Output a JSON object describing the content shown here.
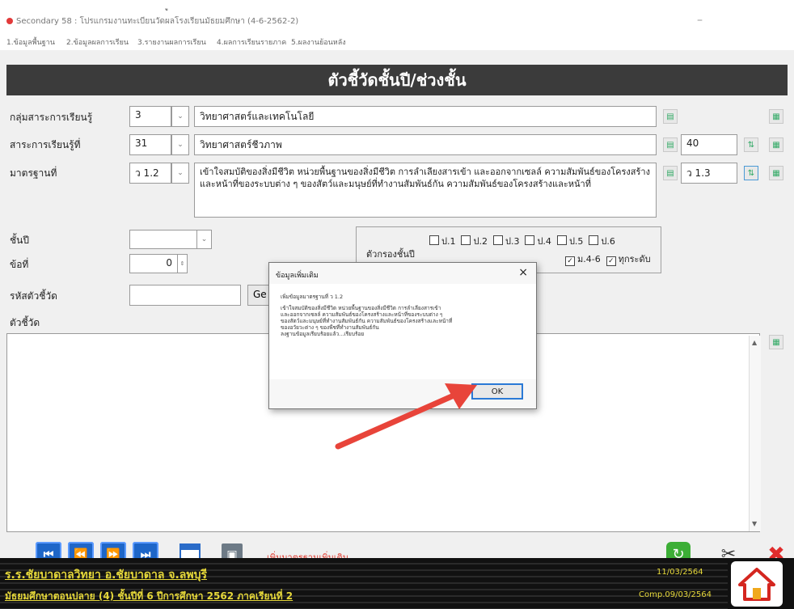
{
  "window": {
    "top_caption": "ู",
    "title": "Secondary 58 : โปรแกรมงานทะเบียนวัดผลโรงเรียนมัธยมศึกษา (4-6-2562-2)",
    "menu": [
      "1.ข้อมูลพื้นฐาน",
      "2.ข้อมูลผลการเรียน",
      "3.รายงานผลการเรียน",
      "4.ผลการเรียนรายภาค",
      "5.ผลงานย้อนหลัง"
    ]
  },
  "header": {
    "title": "ตัวชี้วัดชั้นปี/ช่วงชั้น"
  },
  "form": {
    "learning_area": {
      "label": "กลุ่มสาระการเรียนรู้",
      "code": "3",
      "name": "วิทยาศาสตร์และเทคโนโลยี"
    },
    "strand": {
      "label": "สาระการเรียนรู้ที่",
      "code": "31",
      "name": "วิทยาศาสตร์ชีวภาพ",
      "count": "40"
    },
    "standard": {
      "label": "มาตรฐานที่",
      "code": "ว 1.2",
      "text": "เข้าใจสมบัติของสิ่งมีชีวิต หน่วยพื้นฐานของสิ่งมีชีวิต การลำเลียงสารเข้า และออกจากเซลล์ ความสัมพันธ์ของโครงสร้าง และหน้าที่ของระบบต่าง ๆ ของสัตว์และมนุษย์ที่ทำงานสัมพันธ์กัน ความสัมพันธ์ของโครงสร้างและหน้าที่",
      "next_code": "ว 1.3"
    },
    "grade": {
      "label": "ชั้นปี",
      "value": ""
    },
    "order": {
      "label": "ข้อที่",
      "value": "0"
    },
    "indicator_code": {
      "label": "รหัสตัวชี้วัด",
      "value": "",
      "gen_label": "Ge"
    },
    "indicator": {
      "label": "ตัวชี้วัด",
      "value": ""
    },
    "grade_levels": {
      "label": "ตัวกรองชั้นปี",
      "row1": [
        "ป.1",
        "ป.2",
        "ป.3",
        "ป.4",
        "ป.5",
        "ป.6"
      ],
      "row2_checked": [
        "ม.4-6",
        "ทุกระดับ"
      ]
    }
  },
  "toolbar": {
    "add_standard_label": "เพิ่มมาตรฐานเพิ่มเติม"
  },
  "dialog": {
    "title": "ข้อมูลเพิ่มเติม",
    "close": "×",
    "message_lines": [
      "เพิ่มข้อมูลมาตรฐานที่ ว 1.2",
      "เข้าใจสมบัติของสิ่งมีชีวิต หน่วยพื้นฐานของสิ่งมีชีวิต การลำเลียงสารเข้า",
      "และออกจากเซลล์ ความสัมพันธ์ของโครงสร้างและหน้าที่ของระบบต่าง ๆ",
      "ของสัตว์และมนุษย์ที่ทำงานสัมพันธ์กัน ความสัมพันธ์ของโครงสร้างและหน้าที่",
      "ของอวัยวะต่าง ๆ ของพืชที่ทำงานสัมพันธ์กัน",
      "ลงฐานข้อมูลเรียบร้อยแล้ว...เรียบร้อย"
    ],
    "ok_label": "OK"
  },
  "status": {
    "school": "ร.ร.ชัยบาดาลวิทยา  อ.ชัยบาดาล  จ.ลพบุรี",
    "term": "มัธยมศึกษาตอนปลาย (4)  ชั้นปีที่ 6  ปีการศึกษา 2562  ภาคเรียนที่  2",
    "date": "11/03/2564",
    "comp": "Comp.09/03/2564"
  },
  "colors": {
    "accent": "#1e66c8",
    "status_text": "#e6d83a",
    "header_band": "#3b3b3b",
    "arrow": "#e8443a"
  }
}
